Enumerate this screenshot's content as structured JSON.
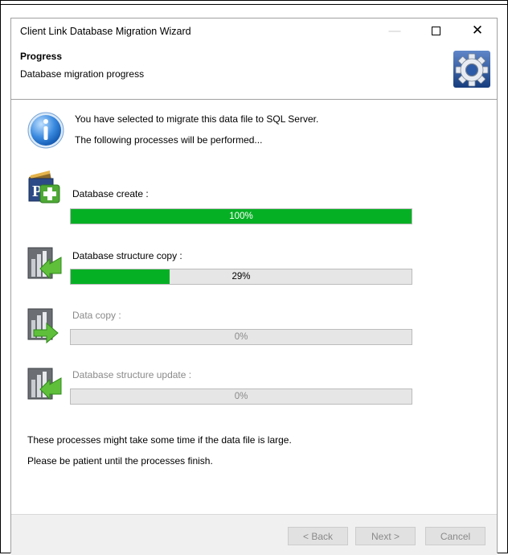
{
  "window": {
    "title": "Client Link Database Migration Wizard",
    "min_glyph": "—",
    "close_glyph": "✕"
  },
  "header": {
    "title": "Progress",
    "subtitle": "Database migration progress"
  },
  "intro": {
    "line1": "You have selected to migrate this data file to SQL Server.",
    "line2": "The following processes will be performed..."
  },
  "steps": [
    {
      "label": "Database create :",
      "progress": 100,
      "progress_text": "100%",
      "active": true
    },
    {
      "label": "Database structure copy :",
      "progress": 29,
      "progress_text": "29%",
      "active": true
    },
    {
      "label": "Data copy :",
      "progress": 0,
      "progress_text": "0%",
      "active": false
    },
    {
      "label": "Database structure update :",
      "progress": 0,
      "progress_text": "0%",
      "active": false
    }
  ],
  "notes": {
    "line1": "These processes might take some time if the data file is large.",
    "line2": "Please be patient until the processes finish."
  },
  "buttons": {
    "back": "< Back",
    "next": "Next >",
    "cancel": "Cancel"
  },
  "colors": {
    "progress_fill": "#06b025",
    "progress_track": "#e6e6e6"
  }
}
